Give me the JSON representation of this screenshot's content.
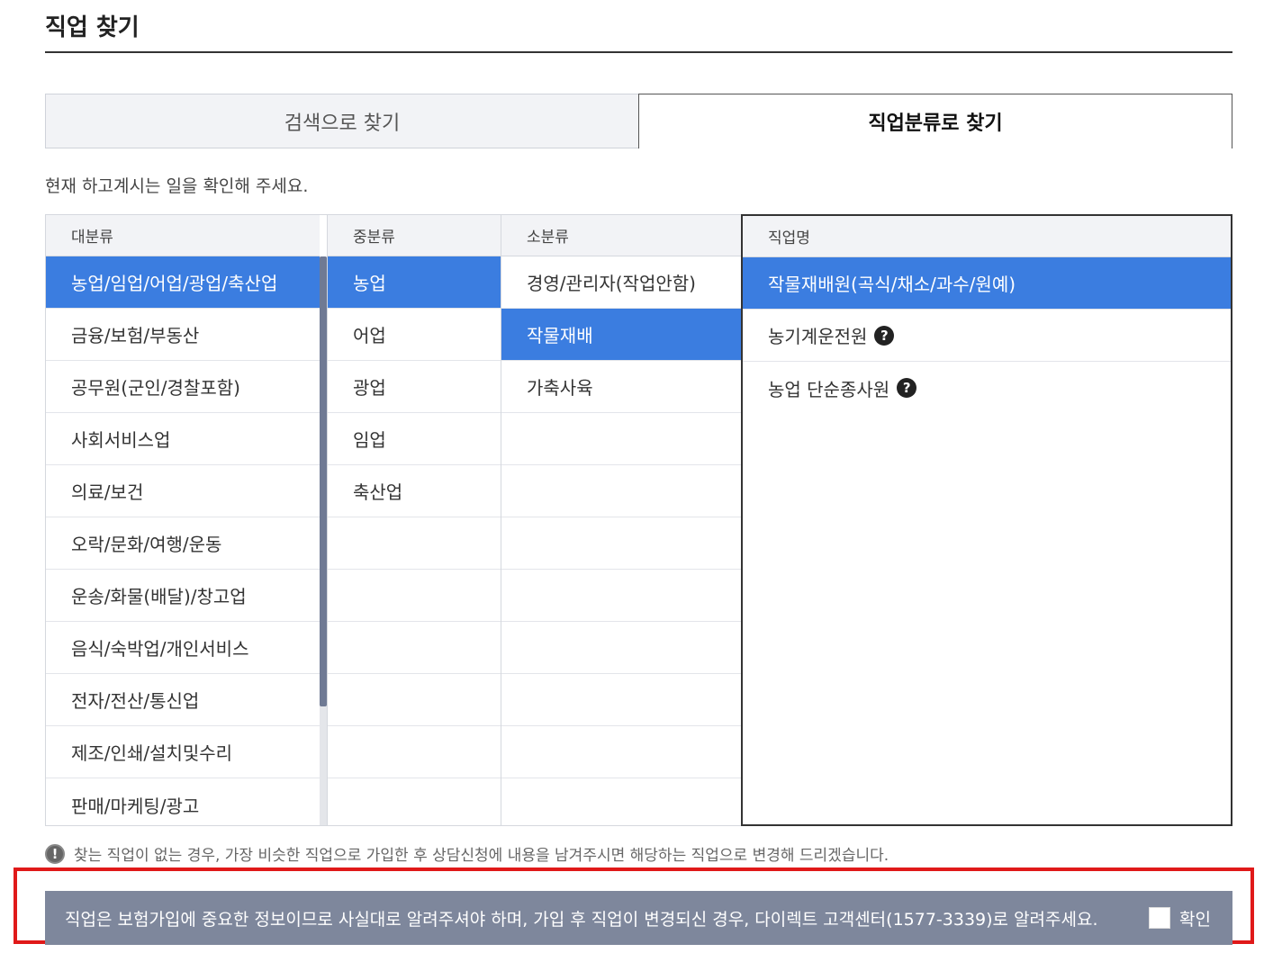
{
  "page": {
    "title": "직업 찾기"
  },
  "tabs": [
    {
      "label": "검색으로 찾기"
    },
    {
      "label": "직업분류로 찾기"
    }
  ],
  "instruction": "현재 하고계시는 일을 확인해 주세요.",
  "columns": {
    "major": {
      "header": "대분류",
      "items": [
        "농업/임업/어업/광업/축산업",
        "금융/보험/부동산",
        "공무원(군인/경찰포함)",
        "사회서비스업",
        "의료/보건",
        "오락/문화/여행/운동",
        "운송/화물(배달)/창고업",
        "음식/숙박업/개인서비스",
        "전자/전산/통신업",
        "제조/인쇄/설치및수리",
        "판매/마케팅/광고"
      ]
    },
    "middle": {
      "header": "중분류",
      "items": [
        "농업",
        "어업",
        "광업",
        "임업",
        "축산업"
      ]
    },
    "minor": {
      "header": "소분류",
      "items": [
        "경영/관리자(작업안함)",
        "작물재배",
        "가축사육"
      ]
    },
    "job": {
      "header": "직업명",
      "items": [
        "작물재배원(곡식/채소/과수/원예)",
        "농기계운전원",
        "농업 단순종사원"
      ]
    }
  },
  "notice": "찾는 직업이 없는 경우, 가장 비슷한 직업으로 가입한 후 상담신청에 내용을 남겨주시면 해당하는 직업으로 변경해 드리겠습니다.",
  "warning": {
    "text": "직업은 보험가입에 중요한 정보이므로 사실대로 알려주셔야 하며, 가입 후 직업이 변경되신 경우, 다이렉트 고객센터(1577-3339)로 알려주세요.",
    "confirm_label": "확인"
  },
  "colors": {
    "selected": "#3b7de0",
    "warning_bar": "#7e879c",
    "highlight": "#e01919"
  }
}
